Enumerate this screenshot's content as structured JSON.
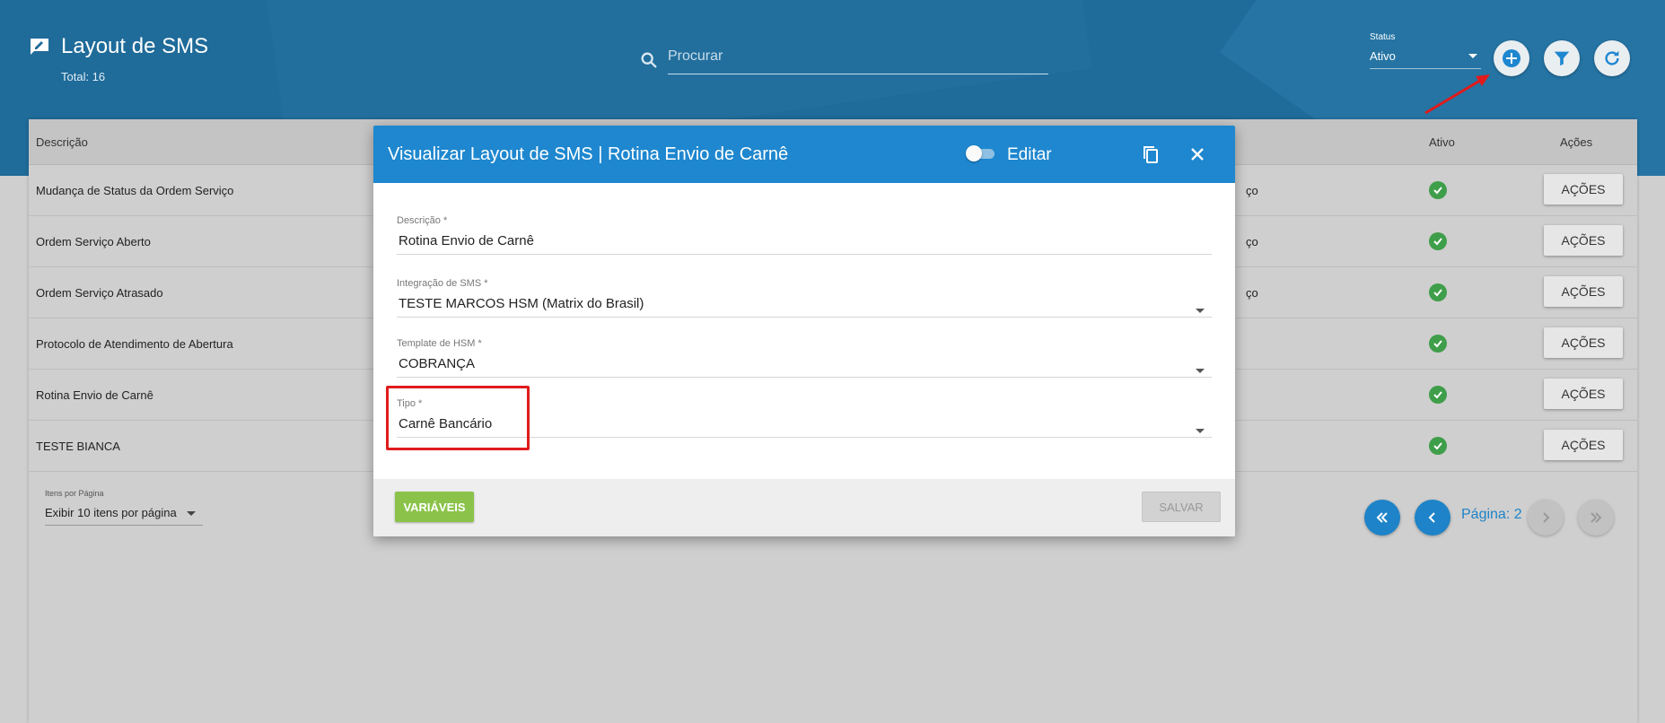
{
  "header": {
    "title": "Layout de SMS",
    "total": "Total: 16",
    "search_placeholder": "Procurar",
    "status_label": "Status",
    "status_value": "Ativo"
  },
  "table": {
    "columns": {
      "descricao": "Descrição",
      "ativo": "Ativo",
      "acoes": "Ações"
    },
    "rows": [
      {
        "descricao": "Mudança de Status da Ordem Serviço",
        "fragment": "ço",
        "action": "AÇÕES"
      },
      {
        "descricao": "Ordem Serviço Aberto",
        "fragment": "ço",
        "action": "AÇÕES"
      },
      {
        "descricao": "Ordem Serviço Atrasado",
        "fragment": "ço",
        "action": "AÇÕES"
      },
      {
        "descricao": "Protocolo de Atendimento de Abertura",
        "fragment": "",
        "action": "AÇÕES"
      },
      {
        "descricao": "Rotina Envio de Carnê",
        "fragment": "",
        "action": "AÇÕES"
      },
      {
        "descricao": "TESTE BIANCA",
        "fragment": "",
        "action": "AÇÕES"
      }
    ]
  },
  "pagination": {
    "per_page_label": "Itens por Página",
    "per_page_value": "Exibir 10 itens por página",
    "page": "Página: 2"
  },
  "modal": {
    "title": "Visualizar Layout de SMS | Rotina Envio de Carnê",
    "edit_label": "Editar",
    "fields": [
      {
        "label": "Descrição *",
        "value": "Rotina Envio de Carnê"
      },
      {
        "label": "Integração de SMS *",
        "value": "TESTE MARCOS HSM (Matrix do Brasil)"
      },
      {
        "label": "Template de HSM *",
        "value": "COBRANÇA"
      },
      {
        "label": "Tipo *",
        "value": "Carnê Bancário"
      }
    ],
    "variables_button": "VARIÁVEIS",
    "save_button": "SALVAR"
  },
  "colors": {
    "header_bg": "#1f6b99",
    "modal_header": "#1e87cf",
    "success": "#3f9e4a",
    "variables_button": "#8bc34a",
    "highlight": "#e01b1b"
  }
}
